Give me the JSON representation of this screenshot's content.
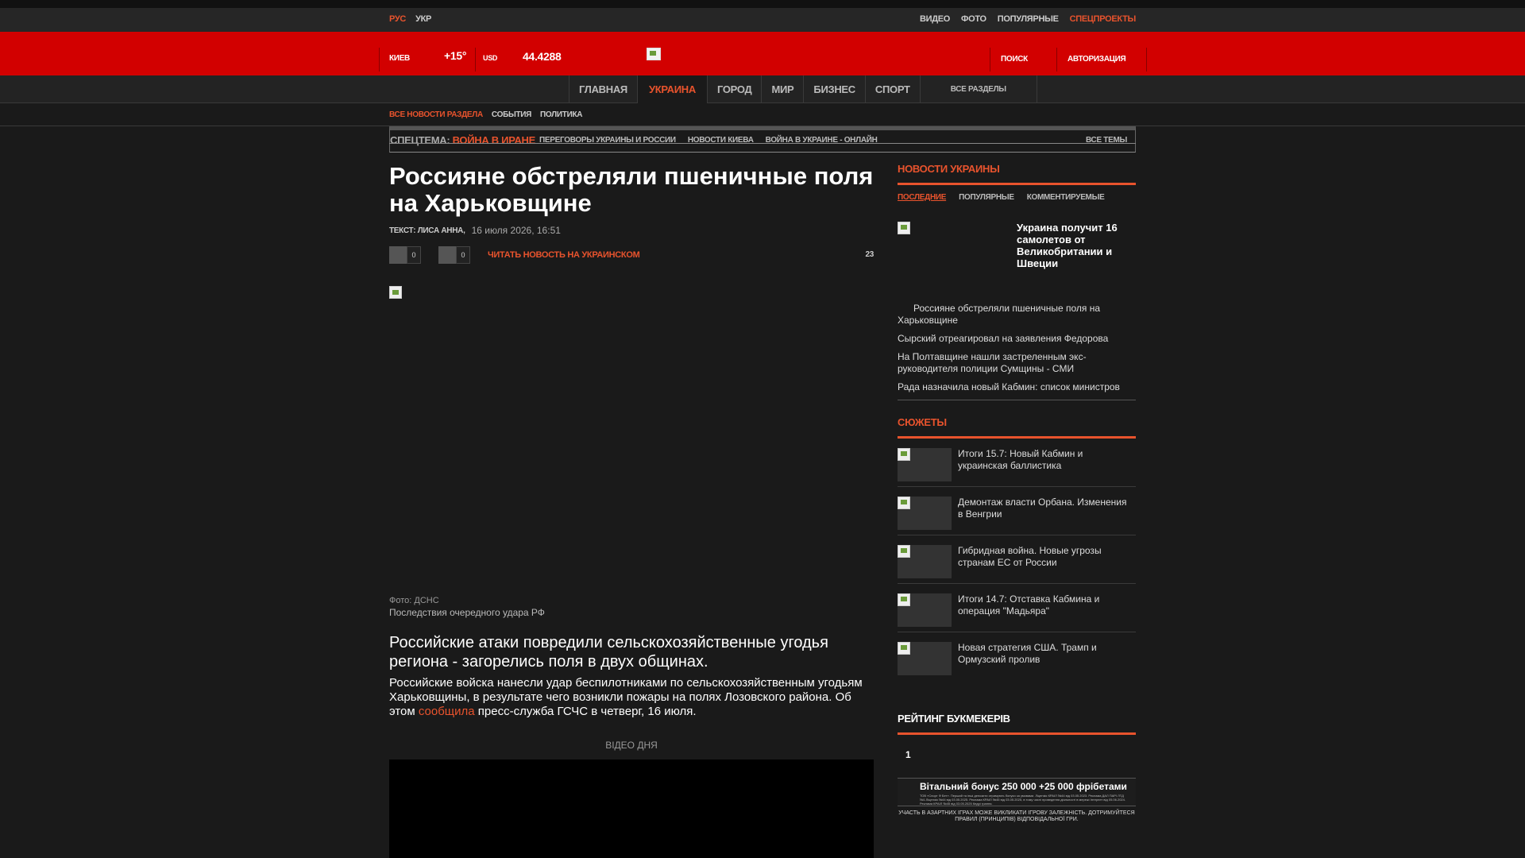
{
  "topbar": {
    "lang_ru": "РУС",
    "lang_ua": "УКР",
    "links": [
      "ВИДЕО",
      "ФОТО",
      "ПОПУЛЯРНЫЕ"
    ],
    "special_link": "СПЕЦПРОЕКТЫ"
  },
  "header": {
    "city": "КИЕВ",
    "temp": "+15°",
    "currency": "USD",
    "rate": "44.4288",
    "search": "ПОИСК",
    "auth": "АВТОРИЗАЦИЯ",
    "brand_color": "#d20000"
  },
  "mainnav": {
    "items": [
      "ГЛАВНАЯ",
      "УКРАИНА",
      "ГОРОД",
      "МИР",
      "БИЗНЕС",
      "СПОРТ"
    ],
    "all": "ВСЕ РАЗДЕЛЫ"
  },
  "subnav": {
    "items": [
      "ВСЕ НОВОСТИ РАЗДЕЛА",
      "СОБЫТИЯ",
      "ПОЛИТИКА"
    ]
  },
  "special": {
    "label": "СПЕЦТЕМА:",
    "hot": "ВОЙНА В ИРАНЕ",
    "links": [
      "ПЕРЕГОВОРЫ УКРАИНЫ И РОССИИ",
      "НОВОСТИ КИЕВА",
      "ВОЙНА В УКРАИНЕ - ОНЛАЙН"
    ],
    "all": "ВСЕ ТЕМЫ"
  },
  "article": {
    "title": "Россияне обстреляли пшеничные поля на Харьковщине",
    "author": "ТЕКСТ: ЛИСА АННА",
    "date": "16 июля 2026, 16:51",
    "share_count_1": "0",
    "share_count_2": "0",
    "read_ua": "ЧИТАТЬ НОВОСТЬ НА УКРАИНСКОМ",
    "views": "23",
    "photo_credit": "Фото: ДСНС",
    "photo_caption": "Последствия очередного удара РФ",
    "lead": "Российские атаки повредили сельскохозяйственные угодья региона - загорелись поля в двух общинах.",
    "body_before": "Российские войска нанесли удар беспилотниками по сельскохозяйственным угодьям Харьковщины, в результате чего возникли пожары на полях Лозовского района. Об этом ",
    "body_link": "сообщила",
    "body_after": " пресс-служба ГСЧС в четверг, 16 июля.",
    "video_day": "ВІДЕО ДНЯ",
    "accent_color": "#e8532d"
  },
  "sidebar": {
    "news_title": "НОВОСТИ УКРАИНЫ",
    "tabs": [
      "ПОСЛЕДНИЕ",
      "ПОПУЛЯРНЫЕ",
      "КОММЕНТИРУЕМЫЕ"
    ],
    "featured": "Украина получит 16 самолетов от Великобритании и Швеции",
    "news": [
      "Россияне обстреляли пшеничные поля на Харьковщине",
      "Сырский отреагировал на заявления Федорова",
      "На Полтавщине нашли застреленным экс-руководителя полиции Сумщины - СМИ",
      "Рада назначила новый Кабмин: список министров"
    ],
    "stories_title": "СЮЖЕТЫ",
    "stories": [
      "Итоги 15.7: Новый Кабмин и украинская баллистика",
      "Демонтаж власти Орбана. Изменения в Венгрии",
      "Гибридная война. Новые угрозы странам ЕС от России",
      "Итоги 14.7: Отставка Кабмина и операция \"Мадьяра\"",
      "Новая стратегия США. Трамп и Ормузский пролив"
    ],
    "rating_title": "РЕЙТИНГ БУКМЕКЕРІВ",
    "rating_rank": "1",
    "bonus_title": "Вітальний бонус 250 000 +25 000 фрібетами",
    "bonus_fine": "ТОВ «Спорт Ф Бет». Перший та інші депозити отримують бонуси за умовами. Ліцензія КРАІЛ №44 від 03.05.2023. Реклама ДАЛ ПАРІ ЛТД №1.Ліцензія №44 від 03.05.2025. Реклама КРАІЛ №45 від 03.05.2025, в тому числі проведення діяльності в мережі Інтернет від 05.06.2024. Реклама КРАІЛ №45 від 03.05.2025 Кедрі грання.",
    "warning": "УЧАСТЬ В АЗАРТНИХ ІГРАХ МОЖЕ ВИКЛИКАТИ ІГРОВУ ЗАЛЕЖНІСТЬ. ДОТРИМУЙТЕСЯ ПРАВИЛ (ПРИНЦИПІВ) ВІДПОВІДАЛЬНОЇ ГРИ."
  }
}
